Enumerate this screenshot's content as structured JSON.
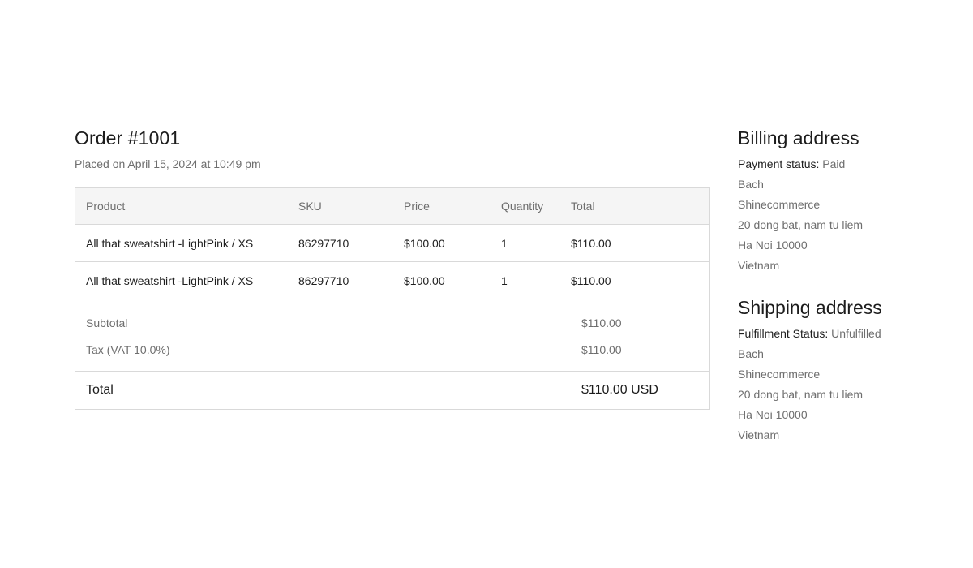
{
  "order": {
    "title": "Order #1001",
    "placed": "Placed on April 15, 2024 at 10:49 pm"
  },
  "table": {
    "headers": {
      "product": "Product",
      "sku": "SKU",
      "price": "Price",
      "quantity": "Quantity",
      "total": "Total"
    },
    "rows": [
      {
        "product": "All that sweatshirt -LightPink / XS",
        "sku": "86297710",
        "price": "$100.00",
        "quantity": "1",
        "total": "$110.00"
      },
      {
        "product": "All that sweatshirt -LightPink / XS",
        "sku": "86297710",
        "price": "$100.00",
        "quantity": "1",
        "total": "$110.00"
      }
    ],
    "subtotal_label": "Subtotal",
    "subtotal_value": "$110.00",
    "tax_label": "Tax (VAT 10.0%)",
    "tax_value": "$110.00",
    "total_label": "Total",
    "total_value": "$110.00 USD"
  },
  "billing": {
    "title": "Billing address",
    "status_label": "Payment status:",
    "status_value": " Paid",
    "lines": [
      "Bach",
      "Shinecommerce",
      "20 dong bat, nam tu liem",
      "Ha Noi 10000",
      "Vietnam"
    ]
  },
  "shipping": {
    "title": "Shipping address",
    "status_label": "Fulfillment Status:",
    "status_value": " Unfulfilled",
    "lines": [
      "Bach",
      "Shinecommerce",
      "20 dong bat, nam tu liem",
      "Ha Noi 10000",
      "Vietnam"
    ]
  }
}
